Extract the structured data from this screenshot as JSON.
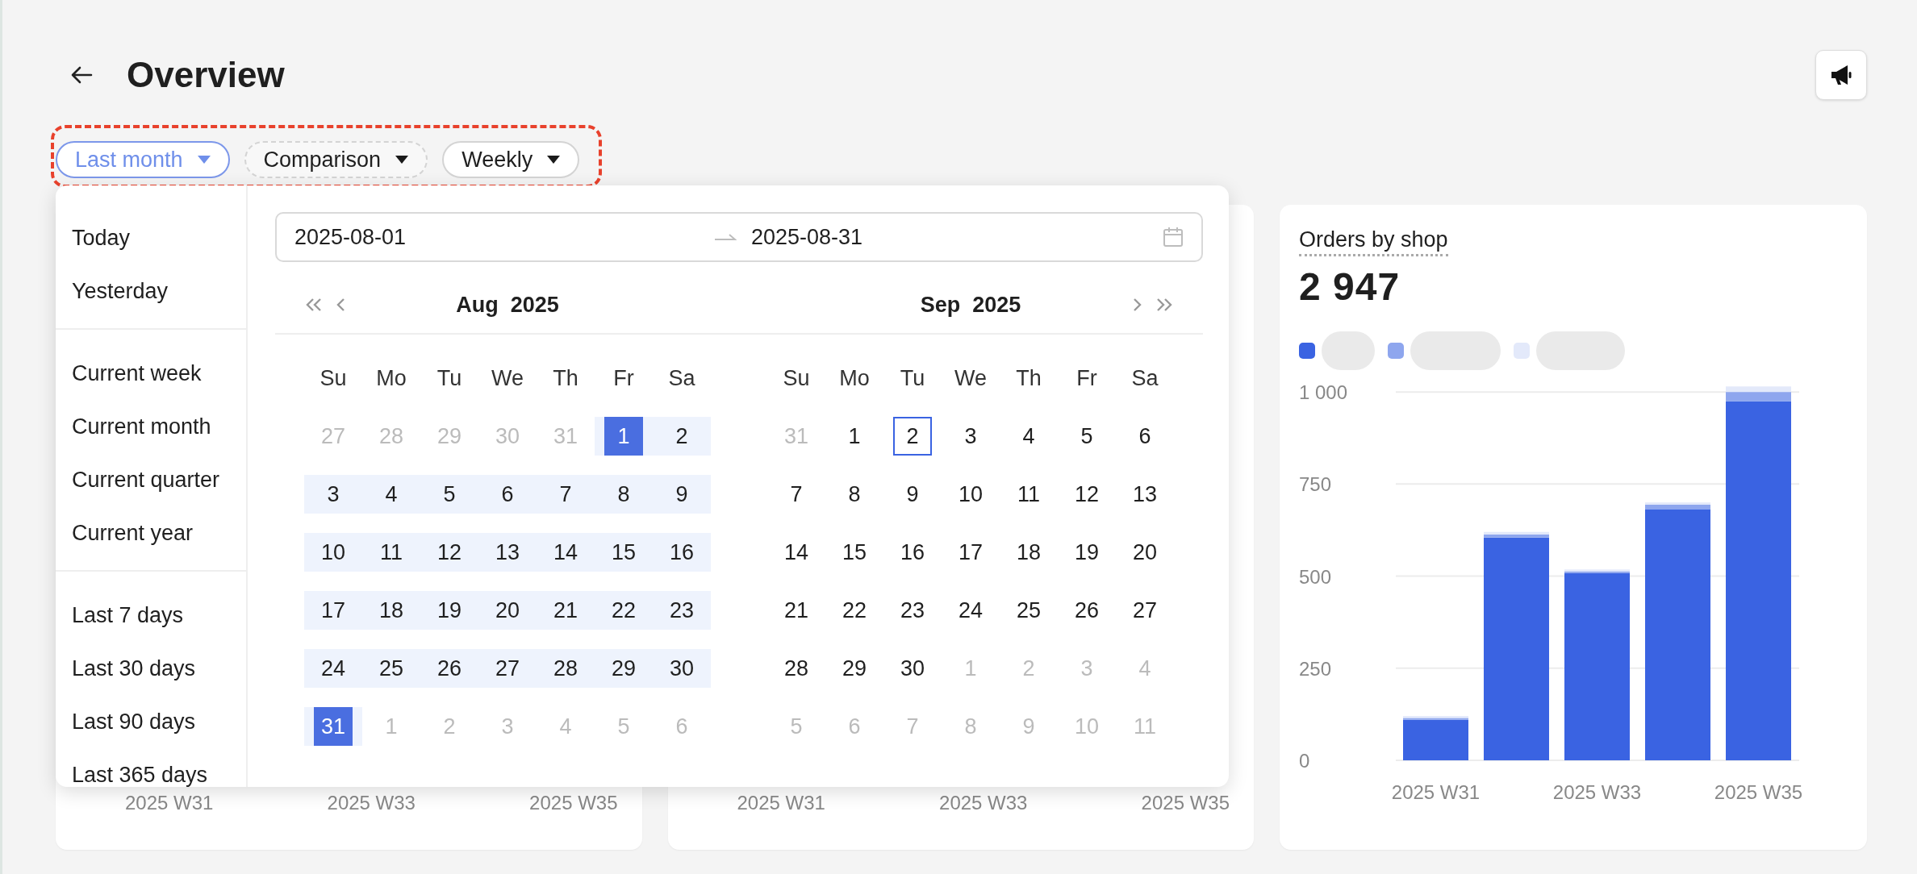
{
  "header": {
    "title": "Overview"
  },
  "filters": [
    {
      "label": "Last month",
      "selected": true,
      "kind": "solid"
    },
    {
      "label": "Comparison",
      "selected": false,
      "kind": "dashed"
    },
    {
      "label": "Weekly",
      "selected": false,
      "kind": "solid"
    }
  ],
  "picker": {
    "preset_groups": [
      [
        "Today",
        "Yesterday"
      ],
      [
        "Current week",
        "Current month",
        "Current quarter",
        "Current year"
      ],
      [
        "Last 7 days",
        "Last 30 days",
        "Last 90 days",
        "Last 365 days"
      ]
    ],
    "range": {
      "start": "2025-08-01",
      "end": "2025-08-31"
    },
    "months": [
      {
        "month": "Aug",
        "year": "2025",
        "weekdays": [
          "Su",
          "Mo",
          "Tu",
          "We",
          "Th",
          "Fr",
          "Sa"
        ],
        "days": [
          {
            "label": "27",
            "kind": "outside",
            "selected": false
          },
          {
            "label": "28",
            "kind": "outside",
            "selected": false
          },
          {
            "label": "29",
            "kind": "outside",
            "selected": false
          },
          {
            "label": "30",
            "kind": "outside",
            "selected": false
          },
          {
            "label": "31",
            "kind": "outside",
            "selected": false
          },
          {
            "label": "1",
            "kind": "range",
            "selected": true
          },
          {
            "label": "2",
            "kind": "range",
            "selected": false
          },
          {
            "label": "3",
            "kind": "range",
            "selected": false
          },
          {
            "label": "4",
            "kind": "range",
            "selected": false
          },
          {
            "label": "5",
            "kind": "range",
            "selected": false
          },
          {
            "label": "6",
            "kind": "range",
            "selected": false
          },
          {
            "label": "7",
            "kind": "range",
            "selected": false
          },
          {
            "label": "8",
            "kind": "range",
            "selected": false
          },
          {
            "label": "9",
            "kind": "range",
            "selected": false
          },
          {
            "label": "10",
            "kind": "range",
            "selected": false
          },
          {
            "label": "11",
            "kind": "range",
            "selected": false
          },
          {
            "label": "12",
            "kind": "range",
            "selected": false
          },
          {
            "label": "13",
            "kind": "range",
            "selected": false
          },
          {
            "label": "14",
            "kind": "range",
            "selected": false
          },
          {
            "label": "15",
            "kind": "range",
            "selected": false
          },
          {
            "label": "16",
            "kind": "range",
            "selected": false
          },
          {
            "label": "17",
            "kind": "range",
            "selected": false
          },
          {
            "label": "18",
            "kind": "range",
            "selected": false
          },
          {
            "label": "19",
            "kind": "range",
            "selected": false
          },
          {
            "label": "20",
            "kind": "range",
            "selected": false
          },
          {
            "label": "21",
            "kind": "range",
            "selected": false
          },
          {
            "label": "22",
            "kind": "range",
            "selected": false
          },
          {
            "label": "23",
            "kind": "range",
            "selected": false
          },
          {
            "label": "24",
            "kind": "range",
            "selected": false
          },
          {
            "label": "25",
            "kind": "range",
            "selected": false
          },
          {
            "label": "26",
            "kind": "range",
            "selected": false
          },
          {
            "label": "27",
            "kind": "range",
            "selected": false
          },
          {
            "label": "28",
            "kind": "range",
            "selected": false
          },
          {
            "label": "29",
            "kind": "range",
            "selected": false
          },
          {
            "label": "30",
            "kind": "range",
            "selected": false
          },
          {
            "label": "31",
            "kind": "range",
            "selected": true
          },
          {
            "label": "1",
            "kind": "outside",
            "selected": false
          },
          {
            "label": "2",
            "kind": "outside",
            "selected": false
          },
          {
            "label": "3",
            "kind": "outside",
            "selected": false
          },
          {
            "label": "4",
            "kind": "outside",
            "selected": false
          },
          {
            "label": "5",
            "kind": "outside",
            "selected": false
          },
          {
            "label": "6",
            "kind": "outside",
            "selected": false
          }
        ]
      },
      {
        "month": "Sep",
        "year": "2025",
        "weekdays": [
          "Su",
          "Mo",
          "Tu",
          "We",
          "Th",
          "Fr",
          "Sa"
        ],
        "days": [
          {
            "label": "31",
            "kind": "outside",
            "selected": false
          },
          {
            "label": "1",
            "kind": "day",
            "selected": false
          },
          {
            "label": "2",
            "kind": "today",
            "selected": false
          },
          {
            "label": "3",
            "kind": "day",
            "selected": false
          },
          {
            "label": "4",
            "kind": "day",
            "selected": false
          },
          {
            "label": "5",
            "kind": "day",
            "selected": false
          },
          {
            "label": "6",
            "kind": "day",
            "selected": false
          },
          {
            "label": "7",
            "kind": "day",
            "selected": false
          },
          {
            "label": "8",
            "kind": "day",
            "selected": false
          },
          {
            "label": "9",
            "kind": "day",
            "selected": false
          },
          {
            "label": "10",
            "kind": "day",
            "selected": false
          },
          {
            "label": "11",
            "kind": "day",
            "selected": false
          },
          {
            "label": "12",
            "kind": "day",
            "selected": false
          },
          {
            "label": "13",
            "kind": "day",
            "selected": false
          },
          {
            "label": "14",
            "kind": "day",
            "selected": false
          },
          {
            "label": "15",
            "kind": "day",
            "selected": false
          },
          {
            "label": "16",
            "kind": "day",
            "selected": false
          },
          {
            "label": "17",
            "kind": "day",
            "selected": false
          },
          {
            "label": "18",
            "kind": "day",
            "selected": false
          },
          {
            "label": "19",
            "kind": "day",
            "selected": false
          },
          {
            "label": "20",
            "kind": "day",
            "selected": false
          },
          {
            "label": "21",
            "kind": "day",
            "selected": false
          },
          {
            "label": "22",
            "kind": "day",
            "selected": false
          },
          {
            "label": "23",
            "kind": "day",
            "selected": false
          },
          {
            "label": "24",
            "kind": "day",
            "selected": false
          },
          {
            "label": "25",
            "kind": "day",
            "selected": false
          },
          {
            "label": "26",
            "kind": "day",
            "selected": false
          },
          {
            "label": "27",
            "kind": "day",
            "selected": false
          },
          {
            "label": "28",
            "kind": "day",
            "selected": false
          },
          {
            "label": "29",
            "kind": "day",
            "selected": false
          },
          {
            "label": "30",
            "kind": "day",
            "selected": false
          },
          {
            "label": "1",
            "kind": "outside",
            "selected": false
          },
          {
            "label": "2",
            "kind": "outside",
            "selected": false
          },
          {
            "label": "3",
            "kind": "outside",
            "selected": false
          },
          {
            "label": "4",
            "kind": "outside",
            "selected": false
          },
          {
            "label": "5",
            "kind": "outside",
            "selected": false
          },
          {
            "label": "6",
            "kind": "outside",
            "selected": false
          },
          {
            "label": "7",
            "kind": "outside",
            "selected": false
          },
          {
            "label": "8",
            "kind": "outside",
            "selected": false
          },
          {
            "label": "9",
            "kind": "outside",
            "selected": false
          },
          {
            "label": "10",
            "kind": "outside",
            "selected": false
          },
          {
            "label": "11",
            "kind": "outside",
            "selected": false
          }
        ]
      }
    ]
  },
  "cards": [
    {
      "kind": "covered",
      "x_labels": [
        "2025 W31",
        "2025 W33",
        "2025 W35"
      ]
    },
    {
      "kind": "covered",
      "x_labels": [
        "2025 W31",
        "2025 W33",
        "2025 W35"
      ]
    },
    {
      "kind": "chart",
      "title": "Orders by shop",
      "value": "2 947",
      "chart_data": {
        "type": "bar",
        "stacked": true,
        "categories": [
          "2025 W31",
          null,
          "2025 W33",
          null,
          "2025 W35"
        ],
        "series": [
          {
            "color": "#3a63e2",
            "values": [
              110,
              605,
              508,
              682,
              975
            ]
          },
          {
            "color": "#8ea6ee",
            "values": [
              5,
              8,
              5,
              12,
              25
            ]
          },
          {
            "color": "#e3e9fa",
            "values": [
              5,
              7,
              5,
              6,
              15
            ]
          }
        ],
        "ylim": [
          0,
          1020
        ],
        "grid": true,
        "yticks": [
          0,
          250,
          500,
          750,
          {
            "value": 1000,
            "label": "1 000"
          }
        ]
      }
    }
  ]
}
